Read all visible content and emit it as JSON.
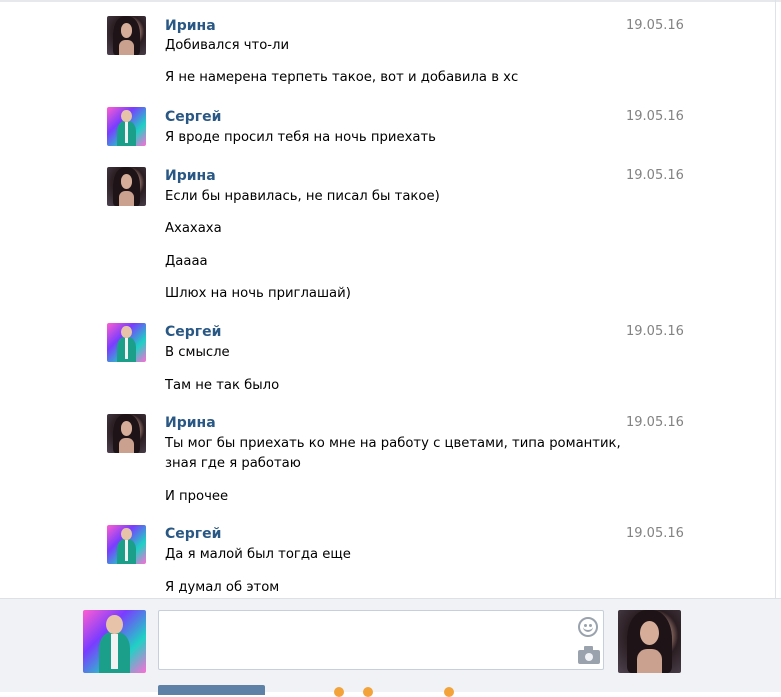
{
  "messages": [
    {
      "author": "Ирина",
      "date": "19.05.16",
      "avatar_icon": "irina-avatar",
      "lines": [
        "Добивался что-ли",
        "Я не намерена терпеть такое, вот и добавила в хс"
      ]
    },
    {
      "author": "Сергей",
      "date": "19.05.16",
      "avatar_icon": "sergey-avatar",
      "lines": [
        "Я вроде просил тебя на ночь приехать"
      ]
    },
    {
      "author": "Ирина",
      "date": "19.05.16",
      "avatar_icon": "irina-avatar",
      "lines": [
        "Если бы нравилась, не писал бы такое)",
        "Ахахаха",
        "Даааа",
        "Шлюх на ночь приглашай)"
      ]
    },
    {
      "author": "Сергей",
      "date": "19.05.16",
      "avatar_icon": "sergey-avatar",
      "lines": [
        "В смысле",
        "Там не так было"
      ]
    },
    {
      "author": "Ирина",
      "date": "19.05.16",
      "avatar_icon": "irina-avatar",
      "lines": [
        "Ты мог бы приехать ко мне на работу с цветами, типа романтик,",
        "зная где я работаю",
        "И прочее"
      ]
    },
    {
      "author": "Сергей",
      "date": "19.05.16",
      "avatar_icon": "sergey-avatar",
      "lines": [
        "Да я малой был тогда еще",
        "Я думал об этом"
      ]
    }
  ],
  "composer": {
    "reply_value": "",
    "smile_icon": "smile-icon",
    "camera_icon": "camera-icon"
  },
  "colors": {
    "author_link": "#2a5885",
    "date_text": "#828282",
    "composer_bg": "#f0f2f5",
    "send_button": "#5e81a8"
  }
}
